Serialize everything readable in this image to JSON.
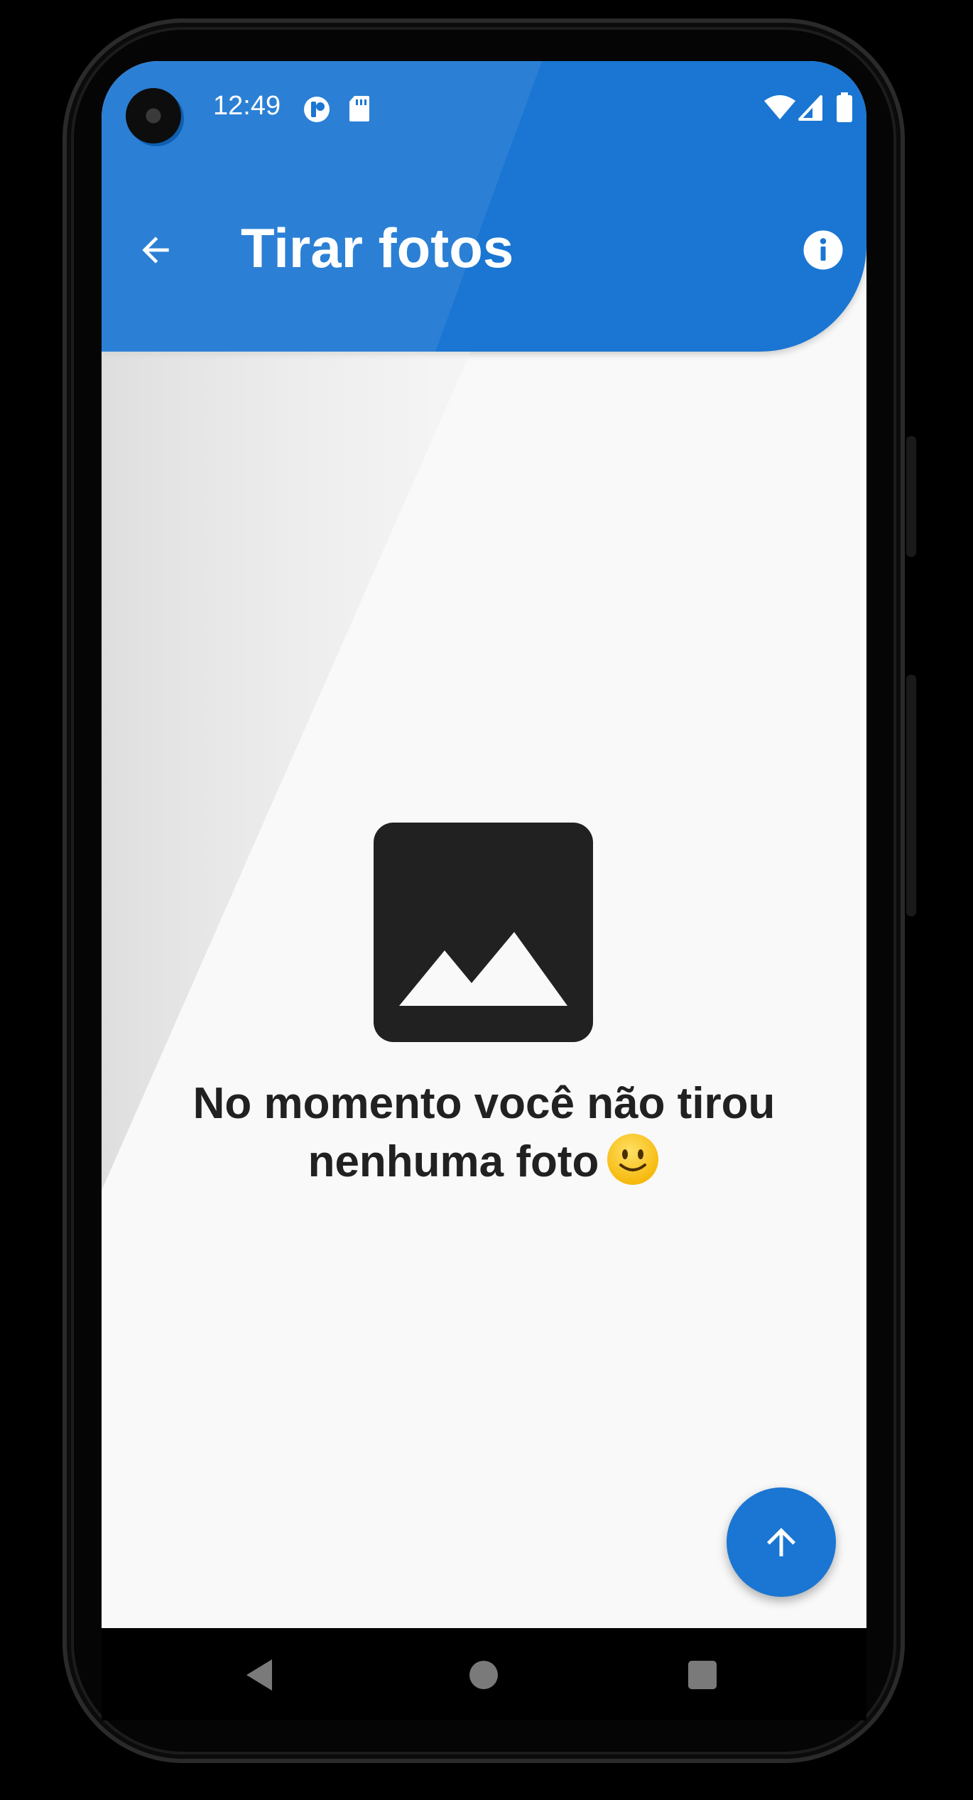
{
  "status_bar": {
    "time": "12:49",
    "icons": [
      "notification-app-icon",
      "sd-card-icon",
      "wifi-icon",
      "signal-icon",
      "battery-icon"
    ]
  },
  "app_bar": {
    "title": "Tirar fotos",
    "back_icon": "arrow-back-icon",
    "action_icon": "info-icon",
    "color": "#1a76d2"
  },
  "empty_state": {
    "icon": "image-placeholder-icon",
    "message": "No momento você não tirou nenhuma foto",
    "emoji_icon": "slightly-smiling-face-icon"
  },
  "fab": {
    "icon": "arrow-upward-icon",
    "color": "#1a76d2"
  },
  "navigation_bar": {
    "buttons": [
      "nav-back-icon",
      "nav-home-icon",
      "nav-recents-icon"
    ]
  }
}
